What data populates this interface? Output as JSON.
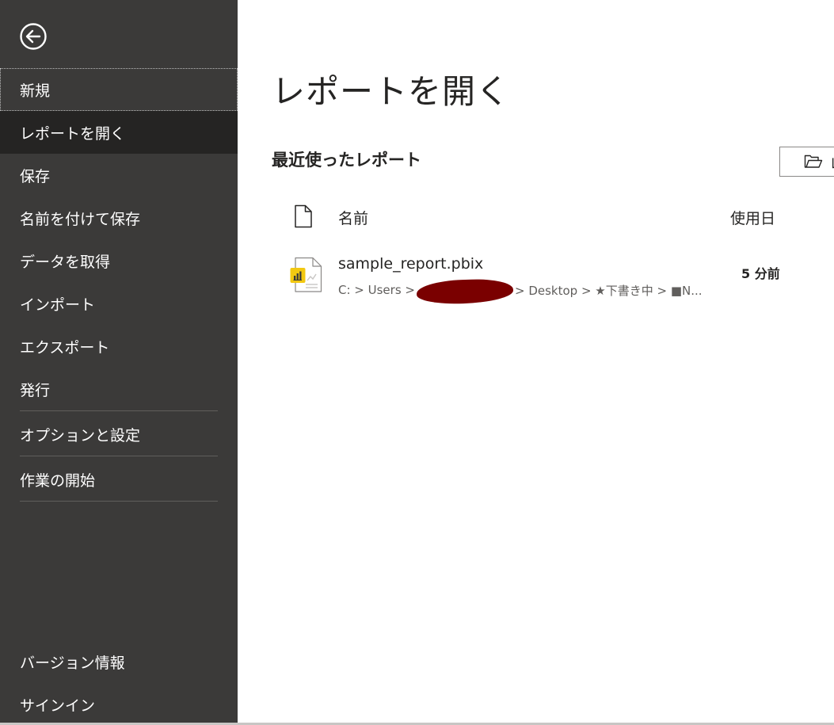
{
  "sidebar": {
    "back_icon": "back-arrow-circle-icon",
    "items": [
      {
        "label": "新規"
      },
      {
        "label": "レポートを開く"
      },
      {
        "label": "保存"
      },
      {
        "label": "名前を付けて保存"
      },
      {
        "label": "データを取得"
      },
      {
        "label": "インポート"
      },
      {
        "label": "エクスポート"
      },
      {
        "label": "発行"
      },
      {
        "label": "オプションと設定"
      },
      {
        "label": "作業の開始"
      }
    ],
    "bottom_items": [
      {
        "label": "バージョン情報"
      },
      {
        "label": "サインイン"
      }
    ],
    "selected_index": 1,
    "focused_index": 0
  },
  "main": {
    "title": "レポートを開く",
    "recent_title": "最近使ったレポート",
    "browse_button": {
      "label": "レ",
      "icon": "folder-open-icon"
    },
    "columns": {
      "name": "名前",
      "date": "使用日",
      "icon": "document-icon"
    },
    "files": [
      {
        "name": "sample_report.pbix",
        "path_start": "C: > Users >",
        "path_end": "> Desktop > ★下書き中 > ■N...",
        "used": "5 分前",
        "icon": "pbix-file-icon"
      }
    ]
  },
  "colors": {
    "sidebar_bg": "#3b3a39",
    "sidebar_selected": "#252423",
    "accent_yellow": "#f2c811",
    "redaction": "#7a0000"
  }
}
